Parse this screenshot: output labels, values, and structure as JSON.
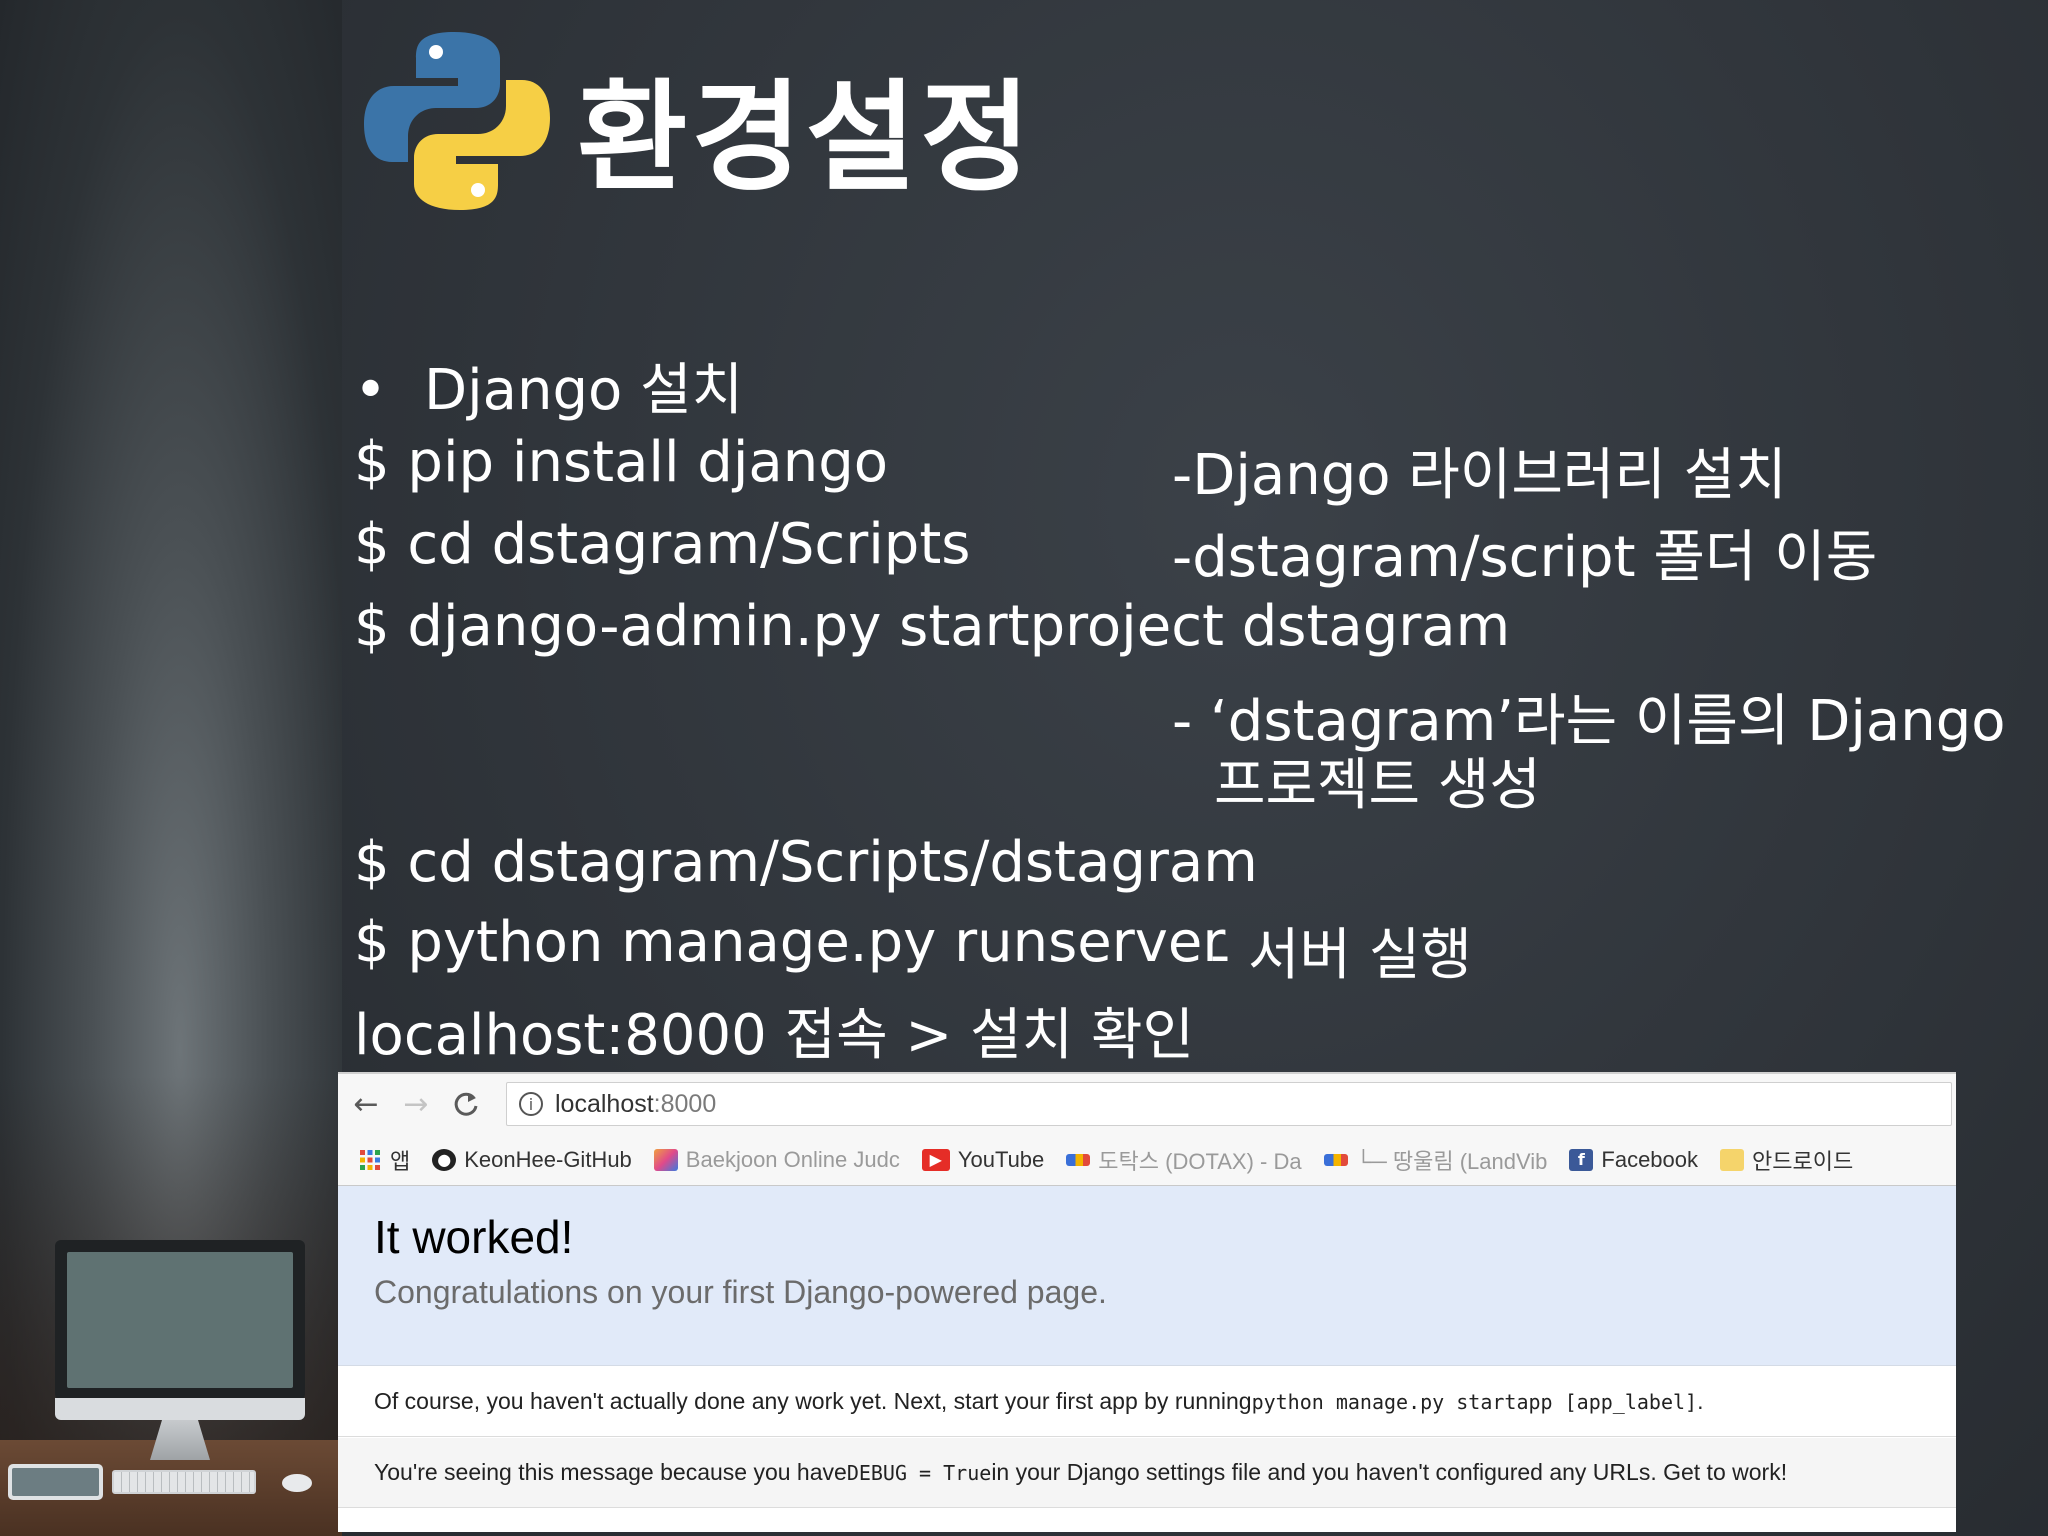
{
  "slide": {
    "title": "환경설정",
    "bullet": "•",
    "bullet_text": "Django 설치",
    "lines": [
      {
        "cmd": "$ pip install django",
        "desc": "-Django 라이브러리 설치"
      },
      {
        "cmd": "$ cd dstagram/Scripts",
        "desc": "-dstagram/script 폴더 이동"
      },
      {
        "cmd": "$ django-admin.py startproject dstagram",
        "desc": ""
      },
      {
        "cmd": "",
        "desc": "- ‘dstagram’라는 이름의 Django"
      },
      {
        "cmd": "",
        "desc": "프로젝트 생성"
      },
      {
        "cmd": "$ cd dstagram/Scripts/dstagram",
        "desc": ""
      },
      {
        "cmd": "$ python manage.py runserver",
        "desc": "- 서버 실행"
      },
      {
        "cmd": "localhost:8000 접속 > 설치 확인",
        "desc": ""
      }
    ]
  },
  "browser": {
    "back_icon": "←",
    "forward_icon": "→",
    "reload_icon": "C",
    "address_host": "localhost",
    "address_port": ":8000",
    "bookmarks": [
      {
        "label": "앱",
        "icon": "apps-grid-icon",
        "color": "#e24a3b"
      },
      {
        "label": "KeonHee-GitHub",
        "icon": "github-icon",
        "color": "#222222"
      },
      {
        "label": "Baekjoon Online Judc",
        "icon": "baekjoon-icon",
        "color": "#f0a040"
      },
      {
        "label": "YouTube",
        "icon": "youtube-icon",
        "color": "#e52d27"
      },
      {
        "label": "도탁스 (DOTAX) - Da",
        "icon": "dotax-icon",
        "color": "#3a6fd8"
      },
      {
        "label": "└─ 땅울림 (LandVib",
        "icon": "landvibe-icon",
        "color": "#3a6fd8"
      },
      {
        "label": "Facebook",
        "icon": "facebook-icon",
        "color": "#3b5998"
      },
      {
        "label": "안드로이드",
        "icon": "folder-icon",
        "color": "#f5d46b"
      }
    ],
    "page": {
      "heading": "It worked!",
      "subheading": "Congratulations on your first Django-powered page.",
      "row1_text": "Of course, you haven't actually done any work yet. Next, start your first app by running ",
      "row1_code": "python manage.py startapp [app_label]",
      "row1_end": ".",
      "row2_text1": "You're seeing this message because you have ",
      "row2_code": "DEBUG = True",
      "row2_text2": " in your Django settings file and you haven't configured any URLs. Get to work!"
    }
  }
}
